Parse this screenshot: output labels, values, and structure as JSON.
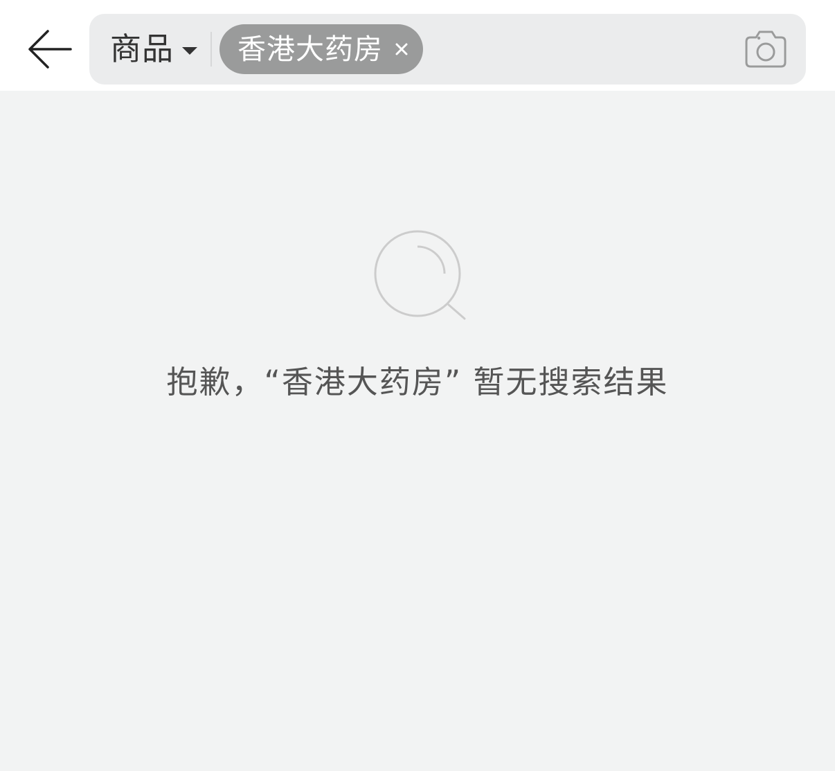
{
  "header": {
    "category_label": "商品",
    "search_tag": "香港大药房",
    "icons": {
      "back": "back-arrow-icon",
      "dropdown": "caret-down-icon",
      "tag_close": "close-icon",
      "camera": "camera-icon"
    }
  },
  "empty_state": {
    "icon": "magnifier-icon",
    "message": "抱歉，“香港大药房” 暂无搜索结果"
  },
  "colors": {
    "page_background": "#f2f3f3",
    "header_background": "#ffffff",
    "search_box_background": "#ebeced",
    "tag_background": "#9a9b9b",
    "icon_gray": "#cccccc",
    "text_dark": "#333333",
    "text_muted": "#555555"
  }
}
